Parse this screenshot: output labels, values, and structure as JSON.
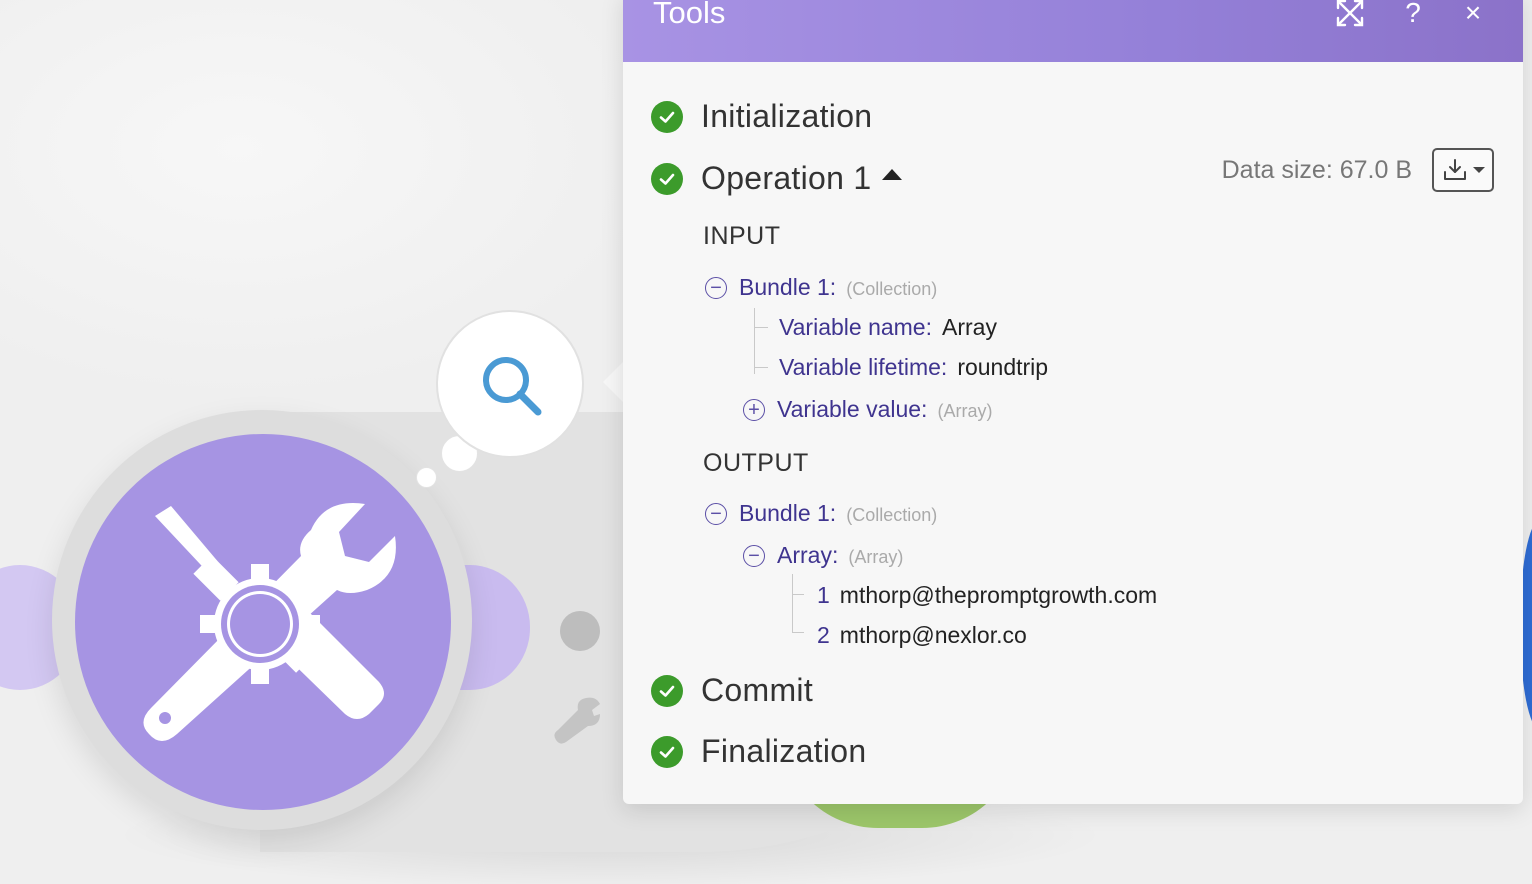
{
  "header": {
    "title": "Tools",
    "icons": [
      "expand-icon",
      "help-icon",
      "close-icon"
    ],
    "help_glyph": "?",
    "close_glyph": "×",
    "color": "#9a86dc"
  },
  "steps": {
    "initialization": "Initialization",
    "operation": "Operation 1",
    "commit": "Commit",
    "finalization": "Finalization",
    "status_color": "#3c9b2b"
  },
  "operation": {
    "data_size": "Data size: 67.0 B"
  },
  "input": {
    "title": "INPUT",
    "bundle_label": "Bundle 1:",
    "bundle_type": "(Collection)",
    "fields": [
      {
        "key": "Variable name:",
        "value": "Array"
      },
      {
        "key": "Variable lifetime:",
        "value": "roundtrip"
      }
    ],
    "value_field": {
      "key": "Variable value:",
      "type": "(Array)"
    }
  },
  "output": {
    "title": "OUTPUT",
    "bundle_label": "Bundle 1:",
    "bundle_type": "(Collection)",
    "array_label": "Array:",
    "array_type": "(Array)",
    "items": [
      {
        "index": "1",
        "value": "mthorp@thepromptgrowth.com"
      },
      {
        "index": "2",
        "value": "mthorp@nexlor.co"
      }
    ]
  },
  "canvas": {
    "module_color": "#a694e3",
    "module_icon": "tools-icon",
    "bubble_icon": "search-icon"
  }
}
